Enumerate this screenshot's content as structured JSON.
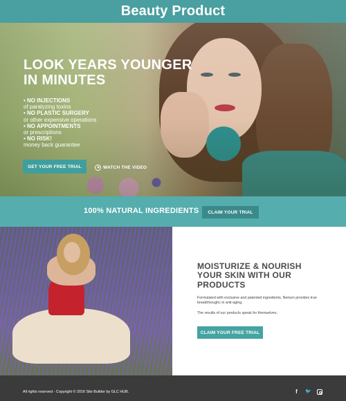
{
  "header": {
    "logo": "Beauty Product"
  },
  "hero": {
    "title_line1": "LOOK YEARS YOUNGER",
    "title_line2": "IN MINUTES",
    "bullets": [
      {
        "main": "• NO INJECTIONS",
        "sub": "of paralyzing toxins"
      },
      {
        "main": "• NO PLASTIC SURGERY",
        "sub": "or other expensive operations"
      },
      {
        "main": "• NO APPOINTMENTS",
        "sub": "or prescriptions"
      },
      {
        "main": "• NO RISK!",
        "sub": "money back guarantee"
      }
    ],
    "cta_label": "GET YOUR FREE TRIAL",
    "video_label": "WATCH THE VIDEO"
  },
  "band": {
    "text": "100% NATURAL INGREDIENTS",
    "button_label": "CLAIM YOUR TRIAL"
  },
  "info": {
    "heading_line1": "MOISTURIZE & NOURISH",
    "heading_line2": "YOUR SKIN WITH OUR",
    "heading_line3": "PRODUCTS",
    "paragraph1": "Formulated with exclusive and patented ingredients, Nerium provides true breakthroughc in anti-aging.",
    "paragraph2": "The results of our products speak for themselves.",
    "button_label": "CLAIM YOUR FREE TRIAL"
  },
  "footer": {
    "copyright": "All rights reserved - Copyright © 2016 Site Builder by GLC HUB.",
    "social": {
      "facebook": "f",
      "twitter": "🐦"
    }
  },
  "colors": {
    "brand_teal": "#4a9fa0",
    "band_teal": "#55adad",
    "button_dark_teal": "#3b8a8b",
    "footer_bg": "#3b3b3b"
  }
}
